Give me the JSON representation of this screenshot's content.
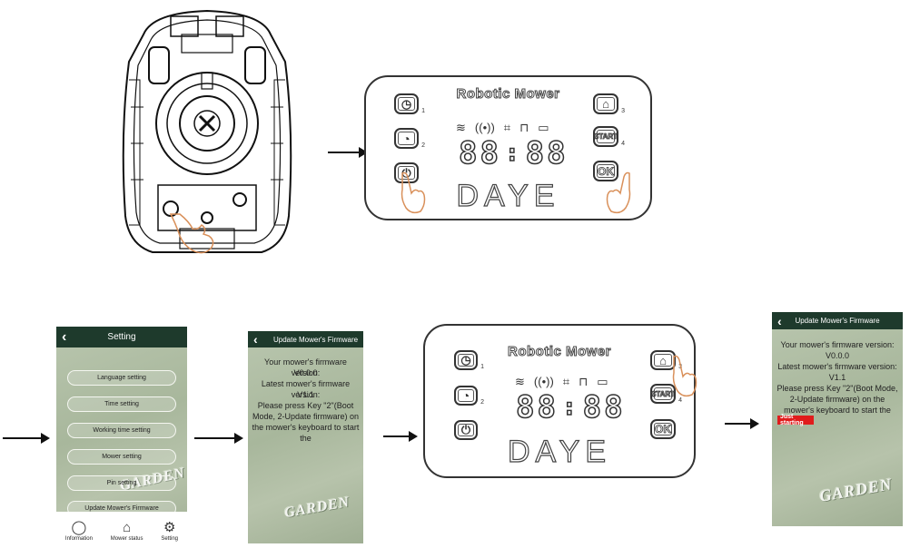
{
  "panel_top": {
    "title": "Robotic Mower",
    "brand": "DAYE",
    "digits_left": "88",
    "digits_sep": ":",
    "digits_right": "88",
    "btn_ok": "OK",
    "btn_start": "START",
    "num_1": "1",
    "num_2": "2",
    "num_3": "3",
    "num_4": "4"
  },
  "setting_screen": {
    "title": "Setting",
    "items": [
      {
        "label": "Language setting"
      },
      {
        "label": "Time setting"
      },
      {
        "label": "Working time setting"
      },
      {
        "label": "Mower setting"
      },
      {
        "label": "Pin setting"
      },
      {
        "label": "Update Mower's Firmware"
      }
    ],
    "watermark": "GARDEN",
    "tabs": [
      {
        "label": "Information",
        "icon": "chat-bubble-icon"
      },
      {
        "label": "Mower status",
        "icon": "home-icon"
      },
      {
        "label": "Setting",
        "icon": "gear-icon"
      }
    ]
  },
  "firmware_screen_a": {
    "title": "Update Mower's Firmware",
    "line1": "Your mower's firmware version:",
    "line2": "V0.0.0",
    "line3": "Latest mower's firmware version:",
    "line4": "V1.1",
    "line5": "Please press Key \"2\"(Boot Mode, 2-Update firmware) on the mower's keyboard to start the",
    "watermark": "GARDEN"
  },
  "panel_bottom": {
    "title": "Robotic Mower",
    "brand": "DAYE",
    "digits_left": "88",
    "digits_sep": ":",
    "digits_right": "88",
    "btn_ok": "OK",
    "btn_start": "START",
    "num_1": "1",
    "num_2": "2",
    "num_3": "3",
    "num_4": "4"
  },
  "firmware_screen_b": {
    "title": "Update Mower's Firmware",
    "line1": "Your mower's firmware version:",
    "line2": "V0.0.0",
    "line3": "Latest mower's firmware version:",
    "line4": "V1.1",
    "line5": "Please press Key \"2\"(Boot Mode, 2-Update firmware) on the mower's keyboard to start the",
    "progress_label": "Just starting",
    "progress_fraction": 0.3,
    "watermark": "GARDEN"
  },
  "colors": {
    "header_green": "#1e3a2c",
    "progress_red": "#e01c1c",
    "finger_orange": "#d9905a"
  }
}
